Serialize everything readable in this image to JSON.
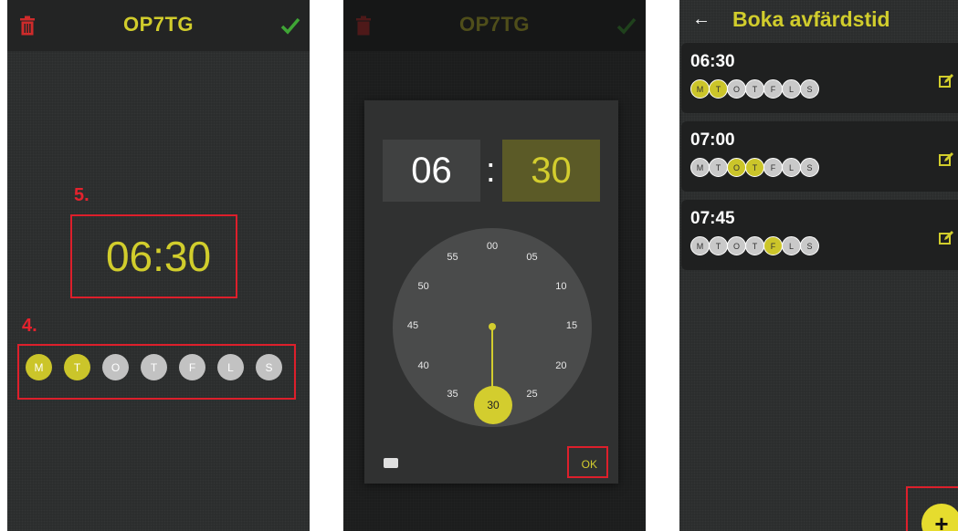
{
  "screen1": {
    "title": "OP7TG",
    "time": "06:30",
    "marker_time": "5.",
    "marker_days": "4.",
    "days": [
      {
        "label": "M",
        "on": true
      },
      {
        "label": "T",
        "on": true
      },
      {
        "label": "O",
        "on": false
      },
      {
        "label": "T",
        "on": false
      },
      {
        "label": "F",
        "on": false
      },
      {
        "label": "L",
        "on": false
      },
      {
        "label": "S",
        "on": false
      }
    ]
  },
  "screen2": {
    "title": "OP7TG",
    "hour": "06",
    "colon": ":",
    "minute": "30",
    "ok_label": "OK",
    "dial": [
      "00",
      "05",
      "10",
      "15",
      "20",
      "25",
      "30",
      "35",
      "40",
      "45",
      "50",
      "55"
    ],
    "selected_minute": "30"
  },
  "screen3": {
    "title": "Boka avfärdstid",
    "back_icon": "←",
    "fab_label": "+",
    "bookings": [
      {
        "time": "06:30",
        "days": [
          {
            "label": "M",
            "on": true
          },
          {
            "label": "T",
            "on": true
          },
          {
            "label": "O",
            "on": false
          },
          {
            "label": "T",
            "on": false
          },
          {
            "label": "F",
            "on": false
          },
          {
            "label": "L",
            "on": false
          },
          {
            "label": "S",
            "on": false
          }
        ]
      },
      {
        "time": "07:00",
        "days": [
          {
            "label": "M",
            "on": false
          },
          {
            "label": "T",
            "on": false
          },
          {
            "label": "O",
            "on": true
          },
          {
            "label": "T",
            "on": true
          },
          {
            "label": "F",
            "on": false
          },
          {
            "label": "L",
            "on": false
          },
          {
            "label": "S",
            "on": false
          }
        ]
      },
      {
        "time": "07:45",
        "days": [
          {
            "label": "M",
            "on": false
          },
          {
            "label": "T",
            "on": false
          },
          {
            "label": "O",
            "on": false
          },
          {
            "label": "T",
            "on": false
          },
          {
            "label": "F",
            "on": true
          },
          {
            "label": "L",
            "on": false
          },
          {
            "label": "S",
            "on": false
          }
        ]
      }
    ]
  },
  "colors": {
    "accent": "#d1cd2c",
    "alert": "#e4222d",
    "confirm": "#3fa535"
  }
}
